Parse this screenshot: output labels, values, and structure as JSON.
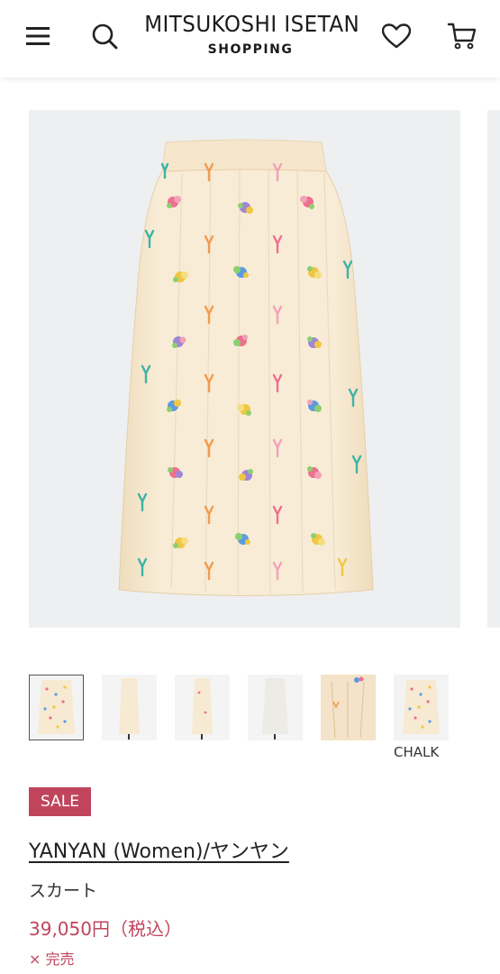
{
  "header": {
    "logo_main": "MITSUKOSHI ISETAN",
    "logo_sub": "SHOPPING",
    "icons": [
      "menu-icon",
      "search-icon",
      "heart-icon",
      "cart-icon"
    ]
  },
  "gallery": {
    "thumbnail_caption": "CHALK",
    "selected_index": 0,
    "thumbnail_count": 6
  },
  "product": {
    "badge": "SALE",
    "brand": "YANYAN (Women)/ヤンヤン",
    "name": "スカート",
    "price": "39,050円（税込）",
    "stock_status": "× 完売"
  },
  "colors": {
    "accent": "#c0455c",
    "skirt": "#f7ead2",
    "image_bg": "#eeeff1"
  }
}
